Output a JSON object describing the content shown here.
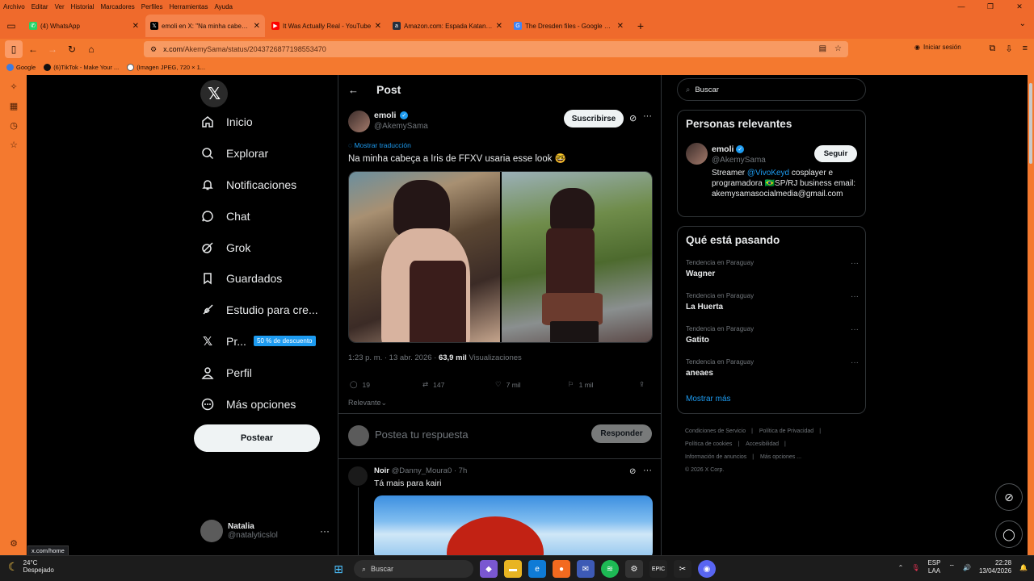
{
  "browser": {
    "menu": [
      "Archivo",
      "Editar",
      "Ver",
      "Historial",
      "Marcadores",
      "Perfiles",
      "Herramientas",
      "Ayuda"
    ],
    "tabs": [
      {
        "label": "(4) WhatsApp",
        "icon": "whatsapp-icon",
        "color": "#25d366"
      },
      {
        "label": "emoli en X: \"Na minha cabeça a",
        "icon": "x-icon",
        "color": "#000000"
      },
      {
        "label": "It Was Actually Real - YouTube",
        "icon": "youtube-icon",
        "color": "#ff0000"
      },
      {
        "label": "Amazon.com: Espada Katana de",
        "icon": "amazon-icon",
        "color": "#232f3e"
      },
      {
        "label": "The Dresden files - Google Sear",
        "icon": "google-icon",
        "color": "#4285f4"
      }
    ],
    "url_host": "x.com",
    "url_path": "/AkemySama/status/2043726877198553470",
    "login_label": "Iniciar sesión",
    "bookmarks": [
      "Google",
      "(6)TikTok - Make Your ...",
      "(Imagen JPEG, 720 × 1..."
    ],
    "status_tip": "x.com/home",
    "accent": "#ef6a2c"
  },
  "nav": {
    "items": [
      "Inicio",
      "Explorar",
      "Notificaciones",
      "Chat",
      "Grok",
      "Guardados",
      "Estudio para cre...",
      "Pr...",
      "Perfil",
      "Más opciones"
    ],
    "premium_badge": "50 % de descuento",
    "post_button": "Postear",
    "account_name": "Natalia",
    "account_handle": "@natalyticslol"
  },
  "post": {
    "header": "Post",
    "author_name": "emoli",
    "author_handle": "@AkemySama",
    "subscribe": "Suscribirse",
    "translate": "Mostrar traducción",
    "text": "Na minha cabeça a Iris de FFXV usaria esse look 🤓",
    "time": "1:23 p. m. · 13 abr. 2026 · ",
    "views_count": "63,9 mil",
    "views_label": " Visualizaciones",
    "replies": "19",
    "reposts": "147",
    "likes": "7 mil",
    "bookmarks": "1 mil",
    "sort": "Relevante",
    "reply_placeholder": "Postea tu respuesta",
    "reply_button": "Responder"
  },
  "reply": {
    "name": "Noir",
    "handle": "@Danny_Moura0 · 7h",
    "text": "Tá mais para kairi"
  },
  "right": {
    "search_placeholder": "Buscar",
    "relevant_title": "Personas relevantes",
    "rel_name": "emoli",
    "rel_handle": "@AkemySama",
    "follow": "Seguir",
    "bio_pre": "Streamer ",
    "bio_link": "@VivoKeyd",
    "bio_post": " cosplayer e programadora 🇧🇷SP/RJ business email: akemysamasocialmedia@gmail.com",
    "trends_title": "Qué está pasando",
    "trends": [
      {
        "context": "Tendencia en Paraguay",
        "name": "Wagner"
      },
      {
        "context": "Tendencia en Paraguay",
        "name": "La Huerta"
      },
      {
        "context": "Tendencia en Paraguay",
        "name": "Gatito"
      },
      {
        "context": "Tendencia en Paraguay",
        "name": "aneaes"
      }
    ],
    "show_more": "Mostrar más",
    "footer": [
      "Condiciones de Servicio",
      "Política de Privacidad",
      "Política de cookies",
      "Accesibilidad",
      "Información de anuncios",
      "Más opciones ...",
      "© 2026 X Corp."
    ]
  },
  "taskbar": {
    "temp": "24°C",
    "weather": "Despejado",
    "search": "Buscar",
    "lang1": "ESP",
    "lang2": "LAA",
    "time": "22:28",
    "date": "13/04/2026"
  }
}
